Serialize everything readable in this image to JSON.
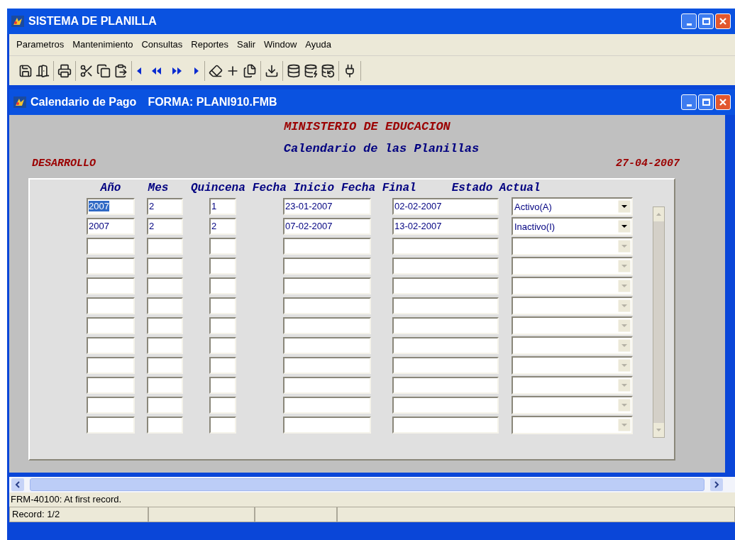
{
  "window": {
    "title": "SISTEMA DE PLANILLA"
  },
  "menu": [
    "Parametros",
    "Mantenimiento",
    "Consultas",
    "Reportes",
    "Salir",
    "Window",
    "Ayuda"
  ],
  "form_window": {
    "title": "Calendario de Pago",
    "form_name": "FORMA: PLANI910.FMB"
  },
  "header": {
    "ministry": "MINISTERIO DE EDUCACION",
    "subtitle": "Calendario de las Planillas",
    "environment": "DESARROLLO",
    "date": "27-04-2007"
  },
  "table": {
    "columns": [
      "Año",
      "Mes",
      "Quincena",
      "Fecha Inicio",
      "Fecha Final",
      "Estado Actual"
    ],
    "rows": [
      {
        "kind": "record",
        "anio": "2007",
        "mes": "2",
        "quincena": "1",
        "fecha_inicio": "23-01-2007",
        "fecha_final": "02-02-2007",
        "estado": "Activo(A)",
        "selected": true
      },
      {
        "kind": "record",
        "anio": "2007",
        "mes": "2",
        "quincena": "2",
        "fecha_inicio": "07-02-2007",
        "fecha_final": "13-02-2007",
        "estado": "Inactivo(I)",
        "selected": false
      },
      {
        "kind": "blank"
      },
      {
        "kind": "blank"
      },
      {
        "kind": "blank"
      },
      {
        "kind": "blank"
      },
      {
        "kind": "blank"
      },
      {
        "kind": "blank"
      },
      {
        "kind": "blank"
      },
      {
        "kind": "blank"
      },
      {
        "kind": "blank"
      },
      {
        "kind": "blank"
      }
    ]
  },
  "status_bar": {
    "message": "FRM-40100: At first record.",
    "record": "Record: 1/2"
  }
}
